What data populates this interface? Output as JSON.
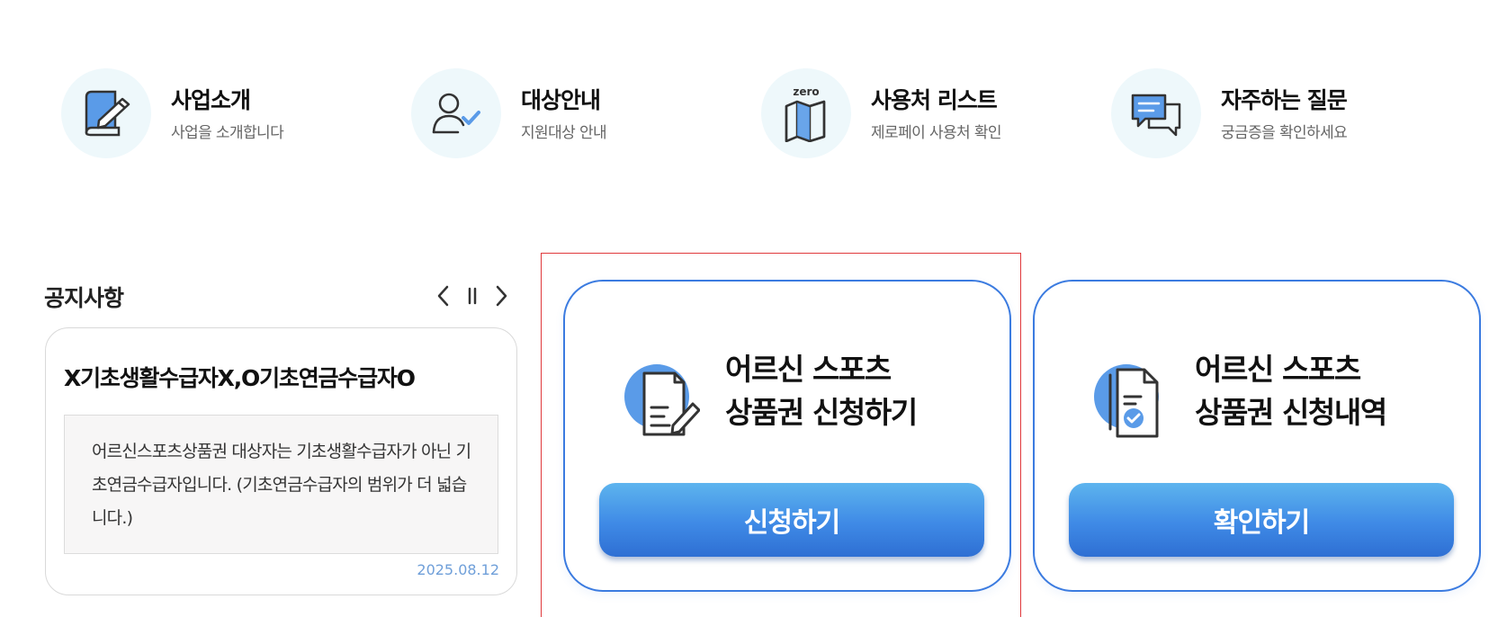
{
  "quick_menu": [
    {
      "title": "사업소개",
      "sub": "사업을 소개합니다",
      "icon": "pen-paper-icon"
    },
    {
      "title": "대상안내",
      "sub": "지원대상 안내",
      "icon": "user-check-icon"
    },
    {
      "title": "사용처 리스트",
      "sub": "제로페이 사용처 확인",
      "icon": "zero-map-icon",
      "icon_label": "zero"
    },
    {
      "title": "자주하는 질문",
      "sub": "궁금증을 확인하세요",
      "icon": "chat-bubble-icon"
    }
  ],
  "notice": {
    "section_title": "공지사항",
    "headline": "X기초생활수급자X,O기초연금수급자O",
    "body": "어르신스포츠상품권 대상자는 기초생활수급자가 아닌 기초연금수급자입니다. (기초연금수급자의 범위가 더 넓습니다.)",
    "date": "2025.08.12",
    "controls": [
      "chevron-left-icon",
      "pause-icon",
      "chevron-right-icon"
    ]
  },
  "apply_card": {
    "title_line1": "어르신 스포츠",
    "title_line2": "상품권 신청하기",
    "button": "신청하기",
    "icon": "document-edit-icon"
  },
  "history_card": {
    "title_line1": "어르신 스포츠",
    "title_line2": "상품권 신청내역",
    "button": "확인하기",
    "icon": "document-check-icon"
  },
  "colors": {
    "accent": "#3b7be0",
    "icon_blue": "#5a9be8",
    "icon_circle_bg": "#eef8fb",
    "highlight": "#e0393c",
    "date": "#6f9fd9"
  }
}
